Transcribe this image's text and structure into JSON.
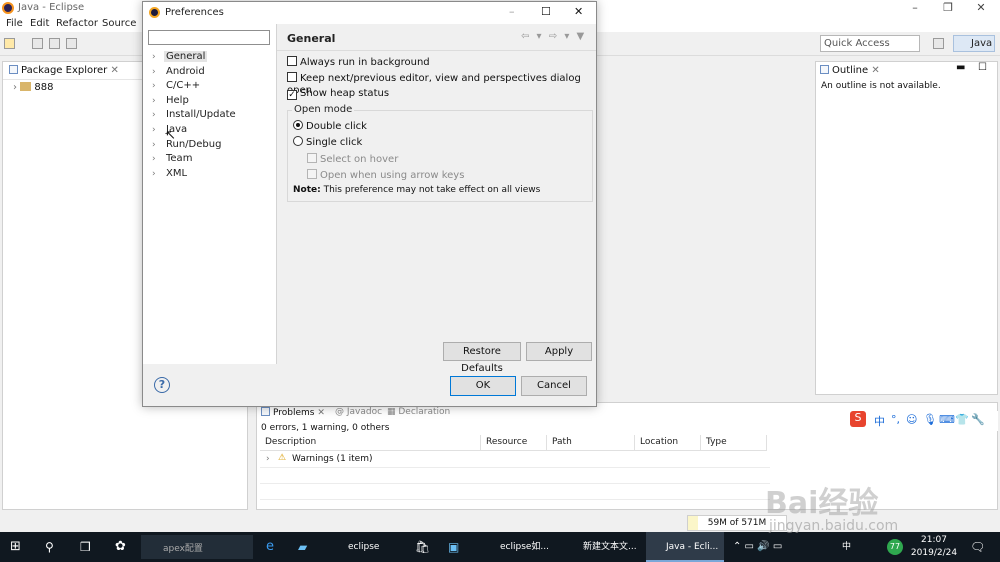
{
  "window": {
    "title": "Java - Eclipse"
  },
  "menu": [
    "File",
    "Edit",
    "Refactor",
    "Source"
  ],
  "toolbar": {
    "quick_access": "Quick Access",
    "perspective": "Java"
  },
  "package_explorer": {
    "title": "Package Explorer",
    "items": [
      "888"
    ]
  },
  "outline": {
    "title": "Outline",
    "message": "An outline is not available."
  },
  "dialog": {
    "title": "Preferences",
    "filter_value": "",
    "tree": [
      {
        "label": "General",
        "selected": true
      },
      {
        "label": "Android",
        "selected": false
      },
      {
        "label": "C/C++",
        "selected": false
      },
      {
        "label": "Help",
        "selected": false
      },
      {
        "label": "Install/Update",
        "selected": false
      },
      {
        "label": "Java",
        "selected": false
      },
      {
        "label": "Run/Debug",
        "selected": false
      },
      {
        "label": "Team",
        "selected": false
      },
      {
        "label": "XML",
        "selected": false
      }
    ],
    "page_title": "General",
    "options": {
      "always_run_bg": {
        "label": "Always run in background",
        "checked": false
      },
      "keep_next_prev": {
        "label": "Keep next/previous editor, view and perspectives dialog open",
        "checked": false
      },
      "show_heap": {
        "label": "Show heap status",
        "checked": true
      }
    },
    "open_mode": {
      "label": "Open mode",
      "double_click": {
        "label": "Double click",
        "selected": true
      },
      "single_click": {
        "label": "Single click",
        "selected": false
      },
      "select_on_hover": {
        "label": "Select on hover",
        "checked": false
      },
      "open_arrow": {
        "label": "Open when using arrow keys",
        "checked": false
      },
      "note_bold": "Note:",
      "note_text": "This preference may not take effect on all views"
    },
    "buttons": {
      "restore": "Restore Defaults",
      "apply": "Apply",
      "ok": "OK",
      "cancel": "Cancel"
    },
    "help": "?"
  },
  "problems": {
    "tabs": [
      "Problems",
      "Javadoc",
      "Declaration"
    ],
    "summary": "0 errors, 1 warning, 0 others",
    "columns": [
      "Description",
      "Resource",
      "Path",
      "Location",
      "Type"
    ],
    "rows": [
      {
        "description": "Warnings (1 item)"
      }
    ]
  },
  "status": {
    "memory": "59M of 571M",
    "memory_fraction": 0.1
  },
  "ime": {
    "chars": [
      "中",
      "°,",
      "☺",
      "🎙",
      "⌨",
      "👕",
      "🔧"
    ]
  },
  "taskbar": {
    "search": "apex配置",
    "items": [
      {
        "label": "eclipse",
        "active": false
      },
      {
        "label": "eclipse如...",
        "active": false
      },
      {
        "label": "新建文本文...",
        "active": false
      },
      {
        "label": "Java - Ecli...",
        "active": true
      }
    ],
    "tray_lang": "中",
    "tray_badge": "77",
    "time": "21:07",
    "date": "2019/2/24"
  },
  "watermark": {
    "main": "Bai经验",
    "sub": "jingyan.baidu.com"
  }
}
